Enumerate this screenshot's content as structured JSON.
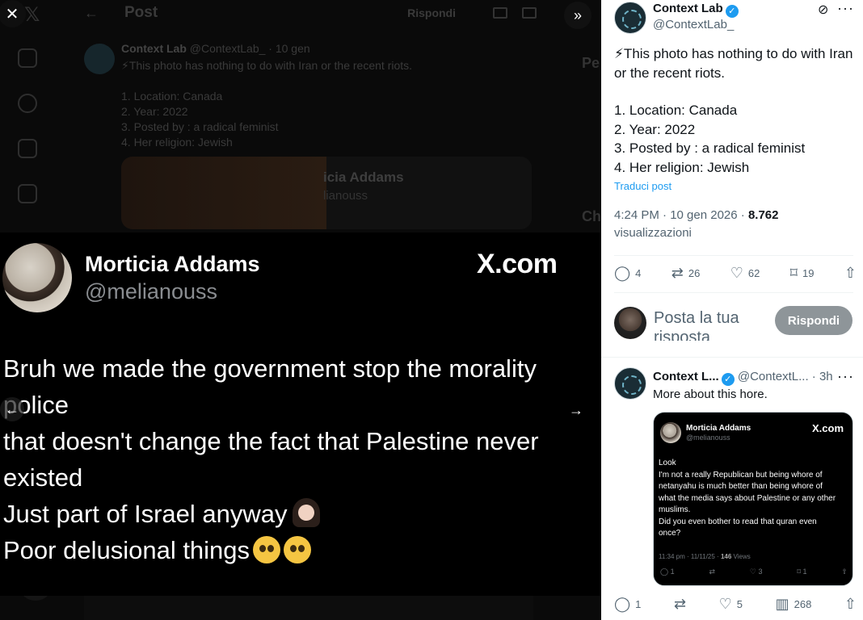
{
  "background": {
    "header_title": "Post",
    "header_reply_label": "Rispondi",
    "post": {
      "author": "Context Lab",
      "handle": "@ContextLab_",
      "date": "· 10 gen",
      "lines": [
        "⚡This photo has nothing to do with Iran or the recent riots.",
        "",
        "1. Location:  Canada",
        "2. Year:   2022",
        "3. Posted by :  a radical feminist",
        "4. Her religion:  Jewish"
      ],
      "media_name": "icia Addams",
      "media_handle": "lianouss"
    },
    "side_heading_1": "Pe",
    "side_heading_2": "Ch"
  },
  "media_view": {
    "name": "Morticia Addams",
    "handle": "@melianouss",
    "brand": "X.com",
    "lines": [
      "Bruh we made the government stop the morality",
      "police",
      "that doesn't change the fact that Palestine never",
      "existed",
      "Just part of Israel anyway",
      "Poor delusional things"
    ]
  },
  "panel": {
    "author": "Context Lab",
    "handle": "@ContextLab_",
    "post_lines": [
      "⚡This photo has nothing to do with Iran or the recent riots.",
      "",
      "1. Location:  Canada",
      "2. Year:   2022",
      "3. Posted by :  a radical feminist",
      "4. Her religion:  Jewish"
    ],
    "translate_label": "Traduci post",
    "time": "4:24 PM · 10 gen 2026 · ",
    "views_count": "8.762",
    "views_label": "visualizzazioni",
    "stats": {
      "replies": "4",
      "reposts": "26",
      "likes": "62",
      "bookmarks": "19"
    },
    "reply_placeholder": "Posta la tua risposta",
    "reply_button": "Rispondi",
    "reply": {
      "author": "Context L...",
      "handle": "@ContextL...",
      "time": "· 3h",
      "text": "More about this hore.",
      "stats": {
        "replies": "1",
        "likes": "5",
        "views": "268"
      }
    },
    "quoted_card": {
      "name": "Morticia Addams",
      "handle": "@melianouss",
      "brand": "X.com",
      "lines": [
        "Look",
        "I'm not a really Republican but being whore of",
        "netanyahu is much better than being whore of",
        "what the media says about Palestine or any other",
        "muslims.",
        "Did you even bother to read that quran even",
        "once?"
      ],
      "meta": "11:34 pm · 11/11/25 · ",
      "views_count": "146",
      "views_label": " Views",
      "stats": {
        "replies": "1",
        "likes": "3",
        "bookmarks": "1"
      }
    }
  },
  "colors": {
    "accent": "#1d9bf0",
    "muted": "#536471",
    "reply_button": "#8e9599"
  },
  "icons": [
    "close-icon",
    "expand-icon",
    "reply-icon",
    "repost-icon",
    "like-icon",
    "bookmark-icon",
    "share-icon",
    "grok-icon",
    "more-icon",
    "views-icon",
    "verified-icon",
    "arrow-left-icon",
    "arrow-right-icon"
  ]
}
